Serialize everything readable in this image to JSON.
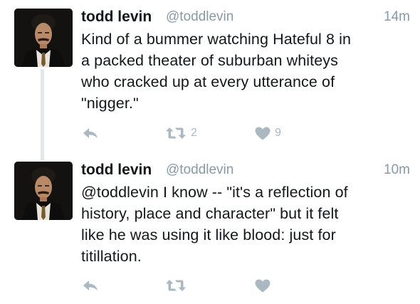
{
  "tweets": [
    {
      "name": "todd levin",
      "handle": "@toddlevin",
      "time": "14m",
      "lines": [
        "Kind of a bummer watching Hateful 8 in",
        "a packed theater of suburban whiteys",
        "who cracked up at every utterance of",
        "\"nigger.\""
      ],
      "retweets": "2",
      "likes": "9"
    },
    {
      "name": "todd levin",
      "handle": "@toddlevin",
      "time": "10m",
      "lines": [
        "@toddlevin I know -- \"it's a reflection of",
        "history, place and character\" but it felt",
        "like he was using it like blood: just for",
        "titillation."
      ],
      "retweets": "",
      "likes": ""
    }
  ],
  "icons": {
    "reply": "reply-icon",
    "retweet": "retweet-icon",
    "like": "heart-icon"
  },
  "colors": {
    "text": "#14171a",
    "muted": "#8899a6",
    "action": "#aab8c2",
    "thread_line": "#e1e8ed"
  }
}
